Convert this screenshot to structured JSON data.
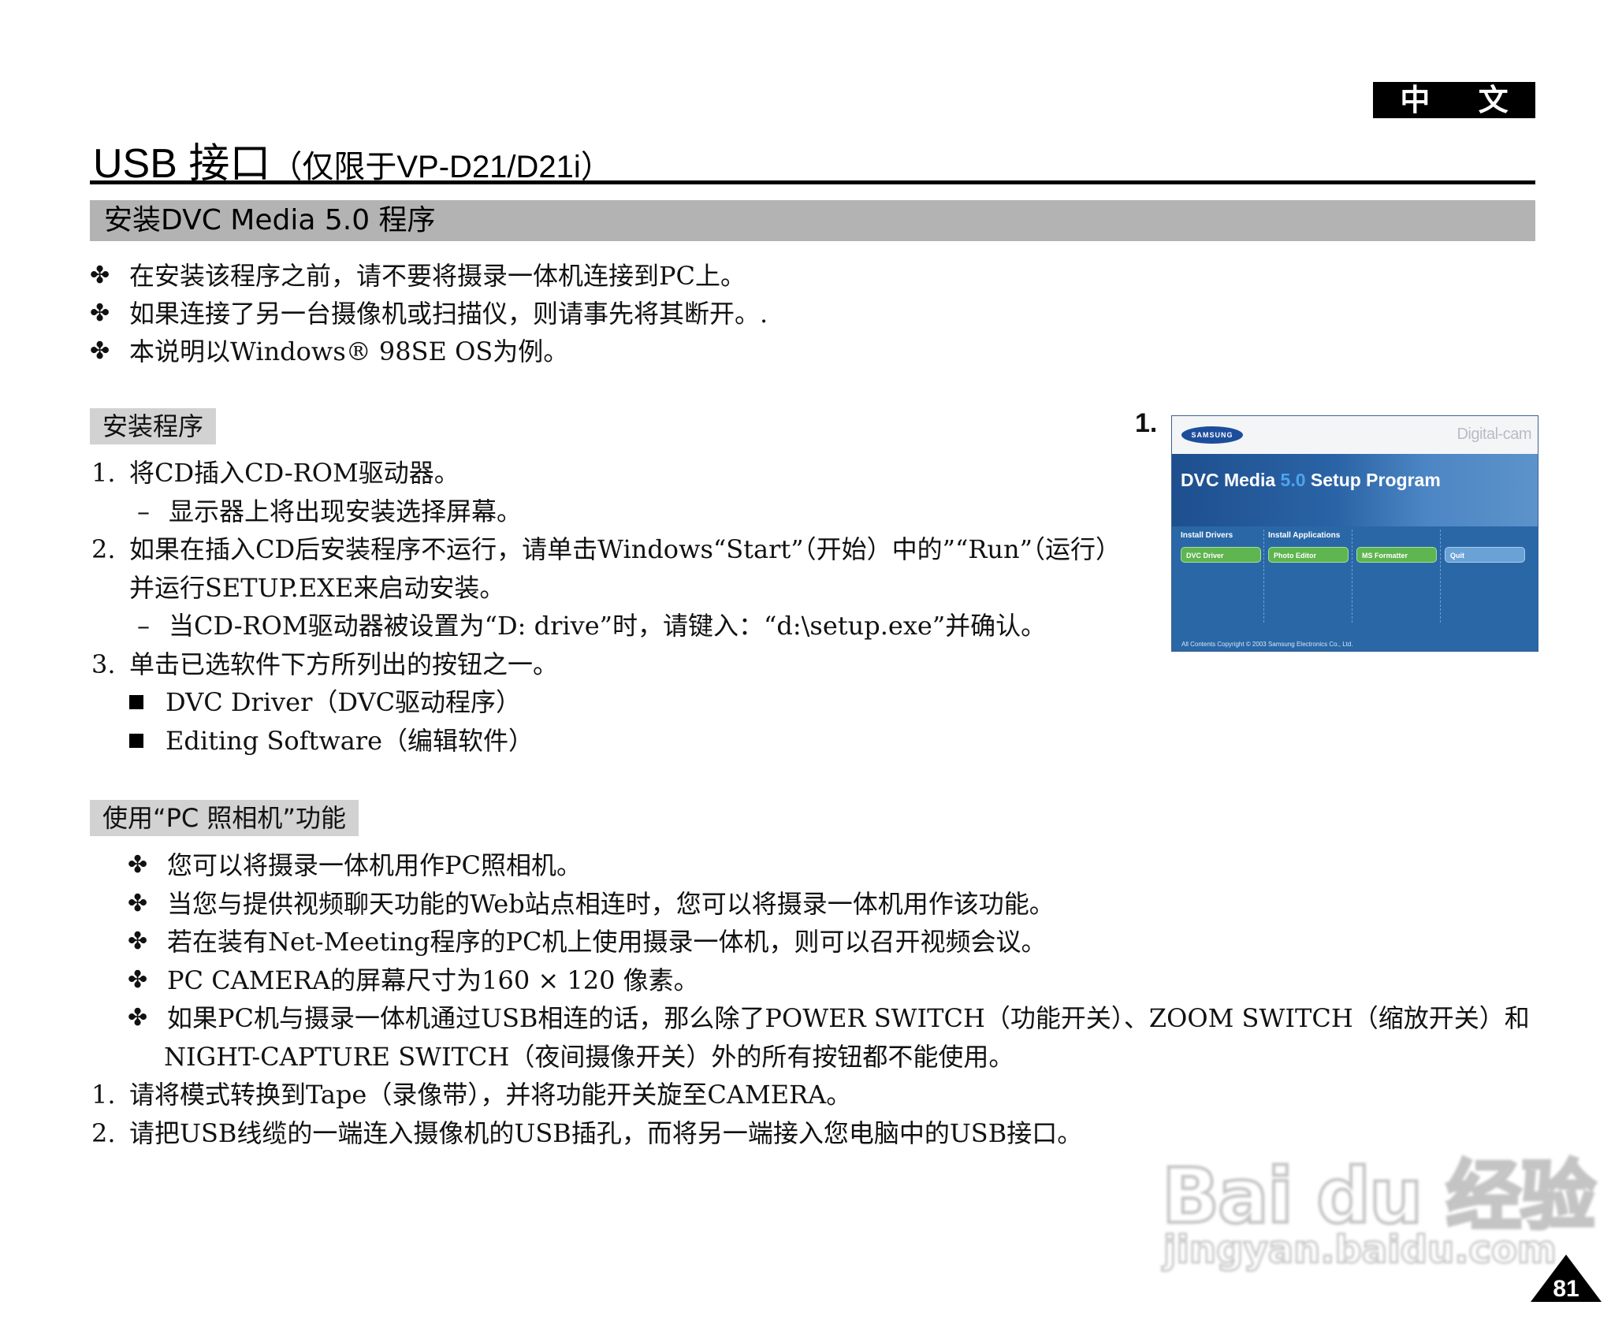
{
  "header": {
    "language_tab": "中 文",
    "title_main": "USB 接口",
    "title_sub": "（仅限于VP-D21/D21i）"
  },
  "section": {
    "title": "安装DVC Media 5.0 程序"
  },
  "notes": [
    "在安装该程序之前，请不要将摄录一体机连接到PC上。",
    "如果连接了另一台摄像机或扫描仪，则请事先将其断开。.",
    "本说明以Windows® 98SE OS为例。"
  ],
  "install": {
    "heading": "安装程序",
    "step1_num": "1.",
    "step1": "将CD插入CD-ROM驱动器。",
    "step1_sub": "显示器上将出现安装选择屏幕。",
    "step2_num": "2.",
    "step2_line1": "如果在插入CD后安装程序不运行，请单击Windows“Start”（开始）中的”“Run”（运行）",
    "step2_line2": "并运行SETUP.EXE来启动安装。",
    "step2_sub": "当CD-ROM驱动器被设置为“D: drive”时，请键入：“d:\\setup.exe”并确认。",
    "step3_num": "3.",
    "step3": "单击已选软件下方所列出的按钮之一。",
    "options": [
      "DVC Driver（DVC驱动程序）",
      "Editing Software（编辑软件）"
    ],
    "dash": "–"
  },
  "pc_camera": {
    "heading": "使用“PC 照相机”功能",
    "notes": [
      "您可以将摄录一体机用作PC照相机。",
      "当您与提供视频聊天功能的Web站点相连时，您可以将摄录一体机用作该功能。",
      "若在装有Net-Meeting程序的PC机上使用摄录一体机，则可以召开视频会议。",
      "PC CAMERA的屏幕尺寸为160 × 120 像素。",
      "如果PC机与摄录一体机通过USB相连的话，那么除了POWER SWITCH（功能开关）、ZOOM SWITCH（缩放开关）和"
    ],
    "note5_cont": "NIGHT-CAPTURE SWITCH（夜间摄像开关）外的所有按钮都不能使用。",
    "step1_num": "1.",
    "step1": "请将模式转换到Tape（录像带），并将功能开关旋至CAMERA。",
    "step2_num": "2.",
    "step2": "请把USB线缆的一端连入摄像机的USB插孔，而将另一端接入您电脑中的USB接口。"
  },
  "bullet_symbol": "✤",
  "screenshot": {
    "label": "1.",
    "logo": "SAMSUNG",
    "digicam": "Digital-cam",
    "title_a": "DVC Media ",
    "title_ver": "5.0",
    "title_b": " Setup Program",
    "col_drivers": "Install Drivers",
    "col_apps": "Install Applications",
    "btn_driver": "DVC Driver",
    "btn_photo": "Photo Editor",
    "btn_ms": "MS Formatter",
    "btn_quit": "Quit",
    "copyright": "All Contents Copyright © 2003 Samsung Electronics Co., Ltd."
  },
  "watermark": {
    "big": "Bai du 经验",
    "small": "jingyan.baidu.com"
  },
  "page_number": "81"
}
